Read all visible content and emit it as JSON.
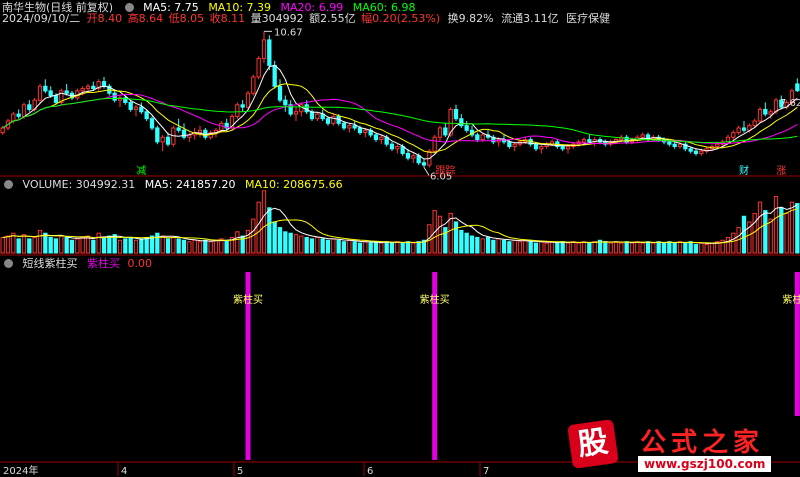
{
  "header": {
    "name": "南华生物(日线 前复权)",
    "ma5": "MA5: 7.75",
    "ma10": "MA10: 7.39",
    "ma20": "MA20: 6.99",
    "ma60": "MA60: 6.98",
    "date": "2024/09/10/二",
    "open": "开8.40",
    "high": "高8.64",
    "low": "低8.05",
    "close": "收8.11",
    "vol": "量304992",
    "amount": "额2.55亿",
    "change": "幅0.20(2.53%)",
    "turnover": "换9.82%",
    "float": "流通3.11亿",
    "sector": "医疗保健"
  },
  "volume_header": {
    "vol": "VOLUME: 304992.31",
    "ma5": "MA5: 241857.20",
    "ma10": "MA10: 208675.66"
  },
  "indicator_header": {
    "name": "短线紫柱买",
    "label": "紫柱买",
    "value": "0.00"
  },
  "colors": {
    "up": "#ff3333",
    "down": "#33ffff",
    "ma5": "#ffffff",
    "ma10": "#ffff00",
    "ma20": "#ff00ff",
    "ma60": "#00ff00",
    "signal": "#e000e0",
    "axis": "#a00000"
  },
  "logo": {
    "char": "股",
    "text": "公式之家",
    "url": "www.gszj100.com"
  },
  "chart_data": {
    "type": "candlestick",
    "price_annotations": [
      {
        "label": "10.67",
        "value": 10.67
      },
      {
        "label": "6.05",
        "value": 6.05
      },
      {
        "label": "7.62",
        "value": 7.62
      }
    ],
    "markers": [
      "减",
      "跟踪",
      "财",
      "涨"
    ],
    "x_ticks": [
      "2024年",
      "4",
      "5",
      "6",
      "7"
    ],
    "signal_label": "紫柱买",
    "signals": [
      46,
      81,
      149
    ],
    "candles": [
      [
        6.3,
        6.6,
        6.2,
        6.5
      ],
      [
        6.5,
        6.9,
        6.4,
        6.8
      ],
      [
        6.8,
        7.2,
        6.7,
        7.1
      ],
      [
        7.1,
        7.3,
        6.9,
        7.0
      ],
      [
        7.0,
        7.6,
        6.9,
        7.5
      ],
      [
        7.5,
        7.7,
        7.2,
        7.3
      ],
      [
        7.3,
        7.8,
        7.2,
        7.7
      ],
      [
        7.7,
        8.4,
        7.6,
        8.3
      ],
      [
        8.3,
        8.6,
        8.0,
        8.1
      ],
      [
        8.1,
        8.3,
        7.8,
        7.9
      ],
      [
        7.9,
        8.0,
        7.5,
        7.6
      ],
      [
        7.6,
        8.2,
        7.5,
        8.1
      ],
      [
        8.1,
        8.4,
        7.9,
        8.0
      ],
      [
        8.0,
        8.1,
        7.7,
        7.8
      ],
      [
        7.8,
        8.2,
        7.7,
        8.1
      ],
      [
        8.1,
        8.3,
        7.9,
        8.2
      ],
      [
        8.2,
        8.4,
        8.0,
        8.3
      ],
      [
        8.3,
        8.5,
        8.1,
        8.2
      ],
      [
        8.2,
        8.6,
        8.1,
        8.5
      ],
      [
        8.5,
        8.7,
        8.2,
        8.3
      ],
      [
        8.3,
        8.4,
        7.9,
        8.0
      ],
      [
        8.0,
        8.1,
        7.6,
        7.7
      ],
      [
        7.7,
        7.9,
        7.4,
        7.8
      ],
      [
        7.8,
        7.9,
        7.5,
        7.6
      ],
      [
        7.6,
        7.7,
        7.2,
        7.3
      ],
      [
        7.3,
        7.5,
        7.0,
        7.4
      ],
      [
        7.4,
        7.6,
        7.1,
        7.2
      ],
      [
        7.2,
        7.3,
        6.8,
        6.9
      ],
      [
        6.9,
        7.0,
        6.4,
        6.5
      ],
      [
        6.5,
        6.6,
        5.8,
        5.9
      ],
      [
        5.9,
        6.2,
        5.5,
        6.1
      ],
      [
        6.1,
        6.3,
        5.7,
        5.8
      ],
      [
        5.8,
        6.6,
        5.7,
        6.5
      ],
      [
        6.5,
        6.9,
        6.3,
        6.4
      ],
      [
        6.4,
        6.7,
        6.0,
        6.1
      ],
      [
        6.1,
        6.3,
        5.9,
        6.2
      ],
      [
        6.2,
        6.5,
        6.0,
        6.3
      ],
      [
        6.3,
        6.6,
        6.1,
        6.4
      ],
      [
        6.4,
        6.5,
        6.0,
        6.1
      ],
      [
        6.1,
        6.4,
        6.0,
        6.3
      ],
      [
        6.3,
        6.5,
        6.1,
        6.4
      ],
      [
        6.4,
        6.8,
        6.3,
        6.7
      ],
      [
        6.7,
        6.9,
        6.4,
        6.5
      ],
      [
        6.5,
        7.1,
        6.4,
        7.0
      ],
      [
        7.0,
        7.6,
        6.9,
        7.5
      ],
      [
        7.5,
        7.7,
        7.2,
        7.4
      ],
      [
        7.4,
        8.1,
        7.3,
        8.0
      ],
      [
        8.0,
        8.8,
        7.9,
        8.7
      ],
      [
        8.7,
        9.6,
        8.6,
        9.5
      ],
      [
        9.5,
        10.67,
        9.3,
        10.3
      ],
      [
        10.3,
        10.5,
        9.0,
        9.2
      ],
      [
        9.2,
        9.4,
        8.2,
        8.3
      ],
      [
        8.3,
        8.6,
        7.6,
        7.7
      ],
      [
        7.7,
        7.9,
        7.2,
        7.5
      ],
      [
        7.5,
        7.7,
        7.0,
        7.1
      ],
      [
        7.1,
        7.4,
        6.8,
        7.2
      ],
      [
        7.2,
        7.6,
        7.0,
        7.5
      ],
      [
        7.5,
        7.7,
        7.1,
        7.2
      ],
      [
        7.2,
        7.3,
        6.8,
        6.9
      ],
      [
        6.9,
        7.2,
        6.8,
        7.1
      ],
      [
        7.1,
        7.3,
        6.8,
        6.9
      ],
      [
        6.9,
        7.0,
        6.6,
        6.7
      ],
      [
        6.7,
        7.1,
        6.6,
        7.0
      ],
      [
        7.0,
        7.1,
        6.6,
        6.7
      ],
      [
        6.7,
        6.8,
        6.4,
        6.5
      ],
      [
        6.5,
        6.7,
        6.3,
        6.6
      ],
      [
        6.6,
        6.8,
        6.4,
        6.5
      ],
      [
        6.5,
        6.6,
        6.2,
        6.3
      ],
      [
        6.3,
        6.5,
        6.1,
        6.4
      ],
      [
        6.4,
        6.5,
        6.1,
        6.2
      ],
      [
        6.2,
        6.3,
        5.9,
        6.0
      ],
      [
        6.0,
        6.2,
        5.8,
        6.1
      ],
      [
        6.1,
        6.2,
        5.7,
        5.8
      ],
      [
        5.8,
        5.9,
        5.5,
        5.6
      ],
      [
        5.6,
        5.8,
        5.4,
        5.7
      ],
      [
        5.7,
        5.8,
        5.3,
        5.4
      ],
      [
        5.4,
        5.6,
        5.1,
        5.2
      ],
      [
        5.2,
        5.4,
        5.0,
        5.3
      ],
      [
        5.3,
        5.4,
        4.9,
        5.0
      ],
      [
        5.0,
        5.2,
        4.8,
        4.9
      ],
      [
        4.9,
        5.6,
        4.8,
        5.5
      ],
      [
        5.5,
        6.2,
        5.4,
        6.1
      ],
      [
        6.1,
        6.6,
        5.9,
        6.5
      ],
      [
        6.5,
        6.7,
        6.1,
        6.2
      ],
      [
        6.2,
        7.4,
        6.1,
        7.3
      ],
      [
        7.3,
        7.5,
        6.8,
        6.9
      ],
      [
        6.9,
        7.1,
        6.5,
        6.6
      ],
      [
        6.6,
        6.8,
        6.3,
        6.4
      ],
      [
        6.4,
        6.6,
        6.1,
        6.2
      ],
      [
        6.2,
        6.3,
        5.9,
        6.0
      ],
      [
        6.0,
        6.3,
        5.9,
        6.2
      ],
      [
        6.2,
        6.4,
        6.0,
        6.1
      ],
      [
        6.1,
        6.2,
        5.8,
        5.9
      ],
      [
        5.9,
        6.1,
        5.7,
        6.0
      ],
      [
        6.0,
        6.2,
        5.8,
        5.9
      ],
      [
        5.9,
        6.0,
        5.6,
        5.7
      ],
      [
        5.7,
        5.9,
        5.5,
        5.8
      ],
      [
        5.8,
        6.0,
        5.7,
        5.9
      ],
      [
        5.9,
        6.1,
        5.8,
        6.0
      ],
      [
        6.0,
        6.1,
        5.7,
        5.8
      ],
      [
        5.8,
        5.9,
        5.5,
        5.6
      ],
      [
        5.6,
        5.8,
        5.4,
        5.7
      ],
      [
        5.7,
        5.9,
        5.6,
        5.8
      ],
      [
        5.8,
        6.0,
        5.7,
        5.9
      ],
      [
        5.9,
        6.0,
        5.6,
        5.7
      ],
      [
        5.7,
        5.8,
        5.5,
        5.6
      ],
      [
        5.6,
        5.8,
        5.4,
        5.7
      ],
      [
        5.7,
        5.9,
        5.6,
        5.8
      ],
      [
        5.8,
        6.0,
        5.7,
        5.9
      ],
      [
        5.9,
        6.1,
        5.8,
        6.0
      ],
      [
        6.0,
        6.2,
        5.8,
        5.9
      ],
      [
        5.9,
        6.1,
        5.7,
        6.0
      ],
      [
        6.0,
        6.1,
        5.8,
        5.9
      ],
      [
        5.9,
        6.0,
        5.7,
        5.8
      ],
      [
        5.8,
        6.0,
        5.7,
        5.9
      ],
      [
        5.9,
        6.1,
        5.8,
        6.0
      ],
      [
        6.0,
        6.2,
        5.9,
        6.1
      ],
      [
        6.1,
        6.2,
        5.8,
        5.9
      ],
      [
        5.9,
        6.1,
        5.8,
        6.0
      ],
      [
        6.0,
        6.2,
        5.9,
        6.1
      ],
      [
        6.1,
        6.3,
        6.0,
        6.2
      ],
      [
        6.2,
        6.3,
        5.9,
        6.0
      ],
      [
        6.0,
        6.2,
        5.9,
        6.1
      ],
      [
        6.1,
        6.2,
        5.9,
        6.0
      ],
      [
        6.0,
        6.1,
        5.8,
        5.9
      ],
      [
        5.9,
        6.0,
        5.7,
        5.8
      ],
      [
        5.8,
        5.9,
        5.6,
        5.7
      ],
      [
        5.7,
        5.9,
        5.6,
        5.8
      ],
      [
        5.8,
        5.9,
        5.5,
        5.6
      ],
      [
        5.6,
        5.7,
        5.4,
        5.5
      ],
      [
        5.5,
        5.6,
        5.3,
        5.4
      ],
      [
        5.4,
        5.6,
        5.3,
        5.5
      ],
      [
        5.5,
        5.7,
        5.4,
        5.6
      ],
      [
        5.6,
        5.8,
        5.5,
        5.7
      ],
      [
        5.7,
        5.9,
        5.6,
        5.8
      ],
      [
        5.8,
        6.0,
        5.7,
        5.9
      ],
      [
        5.9,
        6.2,
        5.8,
        6.1
      ],
      [
        6.1,
        6.4,
        6.0,
        6.3
      ],
      [
        6.3,
        6.6,
        6.2,
        6.5
      ],
      [
        6.5,
        6.8,
        6.3,
        6.4
      ],
      [
        6.4,
        6.7,
        6.3,
        6.6
      ],
      [
        6.6,
        6.9,
        6.5,
        6.8
      ],
      [
        6.8,
        7.4,
        6.7,
        7.3
      ],
      [
        7.3,
        7.6,
        7.0,
        7.1
      ],
      [
        7.1,
        7.3,
        6.9,
        7.2
      ],
      [
        7.2,
        7.8,
        7.1,
        7.7
      ],
      [
        7.7,
        7.9,
        7.3,
        7.4
      ],
      [
        7.4,
        7.7,
        7.3,
        7.6
      ],
      [
        7.6,
        8.2,
        7.5,
        8.1
      ],
      [
        8.4,
        8.64,
        8.05,
        8.11
      ]
    ],
    "volumes": [
      0.55,
      0.6,
      0.7,
      0.5,
      0.65,
      0.5,
      0.55,
      0.8,
      0.7,
      0.55,
      0.5,
      0.6,
      0.55,
      0.45,
      0.5,
      0.55,
      0.6,
      0.45,
      0.7,
      0.55,
      0.6,
      0.65,
      0.45,
      0.5,
      0.55,
      0.45,
      0.5,
      0.55,
      0.6,
      0.7,
      0.6,
      0.5,
      0.55,
      0.5,
      0.45,
      0.4,
      0.45,
      0.4,
      0.45,
      0.4,
      0.45,
      0.5,
      0.45,
      0.55,
      0.75,
      0.6,
      0.8,
      1.2,
      1.8,
      2.2,
      1.6,
      1.1,
      0.9,
      0.75,
      0.7,
      0.65,
      0.6,
      0.55,
      0.5,
      0.55,
      0.5,
      0.45,
      0.5,
      0.45,
      0.4,
      0.45,
      0.4,
      0.35,
      0.4,
      0.35,
      0.4,
      0.35,
      0.4,
      0.35,
      0.4,
      0.35,
      0.4,
      0.35,
      0.4,
      0.45,
      1.0,
      1.5,
      1.3,
      0.9,
      1.4,
      1.1,
      0.8,
      0.7,
      0.6,
      0.55,
      0.5,
      0.55,
      0.45,
      0.5,
      0.45,
      0.4,
      0.45,
      0.4,
      0.45,
      0.4,
      0.35,
      0.4,
      0.35,
      0.4,
      0.35,
      0.4,
      0.35,
      0.4,
      0.35,
      0.4,
      0.35,
      0.4,
      0.45,
      0.4,
      0.35,
      0.4,
      0.35,
      0.4,
      0.35,
      0.4,
      0.35,
      0.4,
      0.35,
      0.4,
      0.35,
      0.4,
      0.35,
      0.4,
      0.35,
      0.4,
      0.3,
      0.35,
      0.3,
      0.35,
      0.4,
      0.45,
      0.55,
      0.7,
      0.9,
      1.3,
      1.1,
      1.4,
      1.8,
      1.5,
      1.2,
      2.0,
      1.6,
      1.4,
      1.8,
      1.75
    ]
  }
}
